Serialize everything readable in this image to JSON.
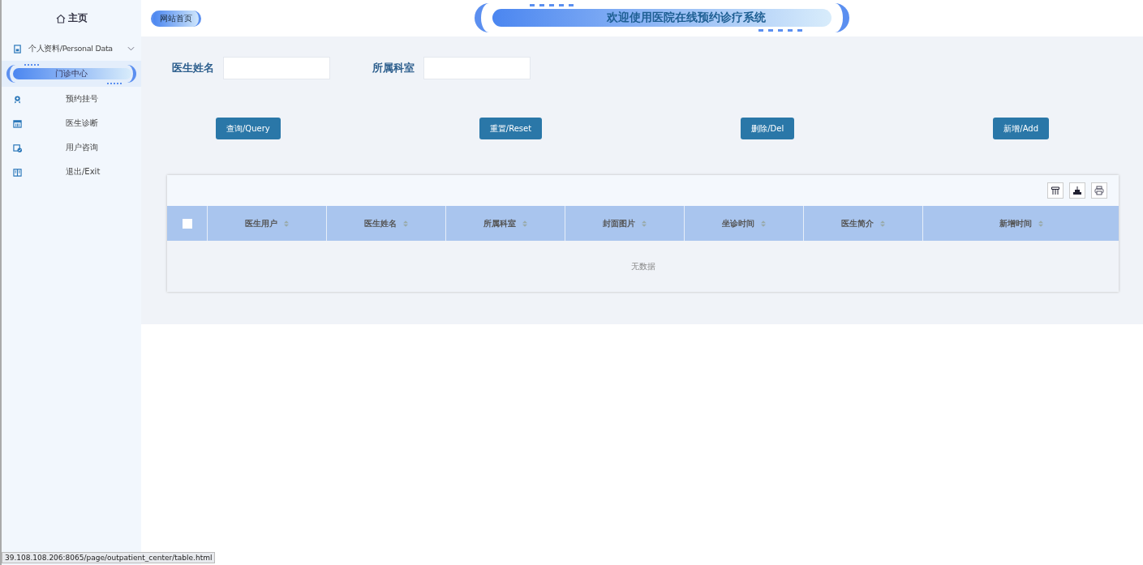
{
  "sidebar": {
    "home": "主页",
    "items": [
      {
        "label": "个人资料/Personal Data",
        "expanded": true,
        "selected": false,
        "children": [
          {
            "label": "门诊中心",
            "selected": true
          }
        ]
      },
      {
        "label": "预约挂号",
        "selected": false
      },
      {
        "label": "医生诊断",
        "selected": false
      },
      {
        "label": "用户咨询",
        "selected": false
      },
      {
        "label": "退出/Exit",
        "selected": false
      }
    ]
  },
  "header": {
    "home_link": "网站首页",
    "title": "欢迎使用医院在线预约诊疗系统"
  },
  "filters": [
    {
      "label": "医生姓名"
    },
    {
      "label": "所属科室"
    }
  ],
  "buttons": [
    "查询/Query",
    "重置/Reset",
    "删除/Del",
    "新增/Add"
  ],
  "table": {
    "select_all": {
      "checked": false
    },
    "columns": [
      "医生用户",
      "医生姓名",
      "所属科室",
      "封面图片",
      "坐诊时间",
      "医生简介",
      "新增时间"
    ],
    "empty_text": "无数据"
  },
  "status_bar": {
    "url": "39.108.108.206:8065/page/outpatient_center/table.html"
  }
}
